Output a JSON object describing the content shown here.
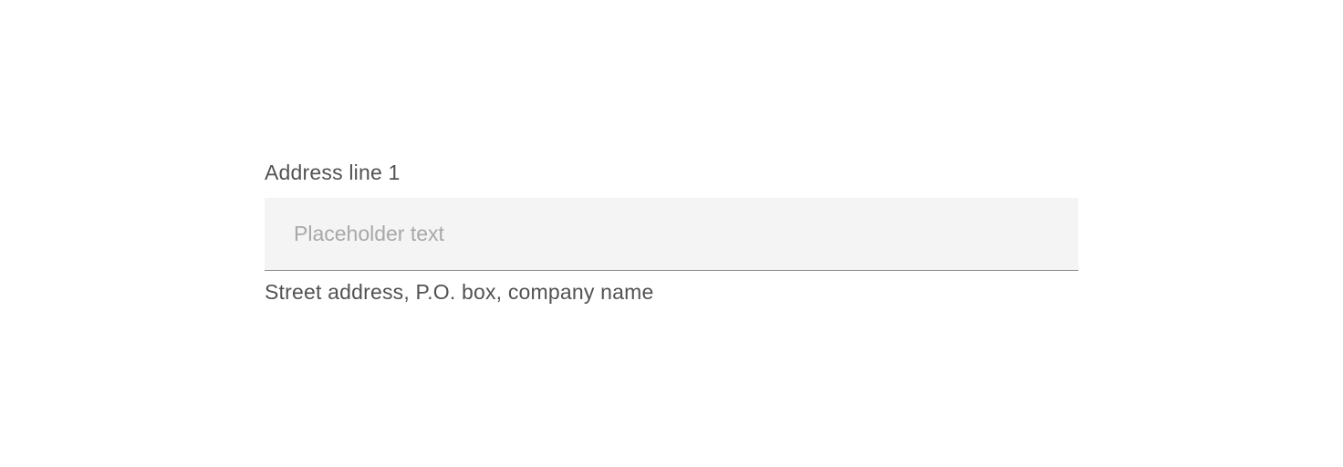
{
  "form": {
    "address1": {
      "label": "Address line 1",
      "placeholder": "Placeholder text",
      "helper": "Street address, P.O. box, company name",
      "value": ""
    }
  }
}
